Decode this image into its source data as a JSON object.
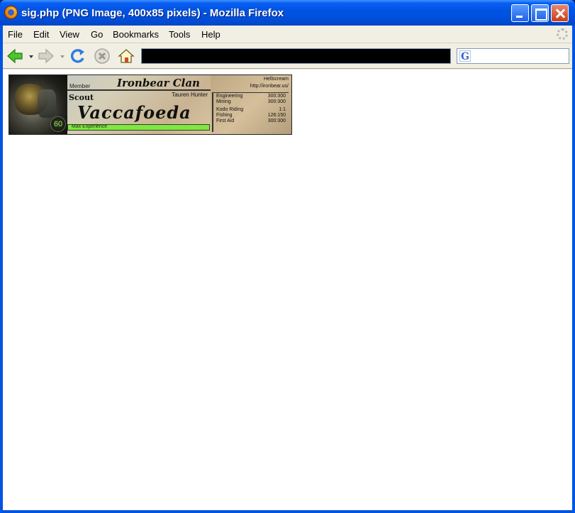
{
  "window": {
    "title": "sig.php (PNG Image, 400x85 pixels) - Mozilla Firefox"
  },
  "menubar": {
    "items": [
      "File",
      "Edit",
      "View",
      "Go",
      "Bookmarks",
      "Tools",
      "Help"
    ]
  },
  "navbar": {
    "icons": [
      "back-arrow-icon",
      "forward-arrow-icon",
      "reload-icon",
      "stop-icon",
      "home-icon"
    ],
    "url": "",
    "search_engine": "G"
  },
  "signature": {
    "member_label": "Member",
    "clan": "Ironbear Clan",
    "realm": "Hellscream",
    "site": "http://ironbear.us/",
    "class": "Tauren Hunter",
    "rank": "Scout",
    "name": "Vaccafoeda",
    "level": "60",
    "xp_text": "Max Experience",
    "xp_fraction": 1.0,
    "skills": [
      {
        "name": "Engineering",
        "value": "300:300"
      },
      {
        "name": "Mining",
        "value": "300:300"
      },
      {
        "name": "Kodo Riding",
        "value": "1:1"
      },
      {
        "name": "Fishing",
        "value": "126:150"
      },
      {
        "name": "First Aid",
        "value": "300:300"
      }
    ]
  }
}
